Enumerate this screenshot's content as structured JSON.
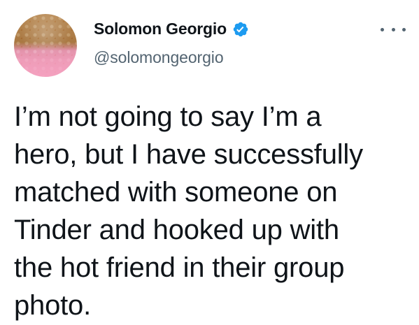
{
  "author": {
    "display_name": "Solomon Georgio",
    "handle": "@solomongeorgio",
    "verified": true,
    "verified_color": "#1d9bf0"
  },
  "actions": {
    "more_icon": "more-horizontal-icon"
  },
  "tweet": {
    "text": "I’m not going to say I’m a\nhero, but I have successfully\nmatched with someone on\nTinder and hooked up with\nthe hot friend in their group\nphoto."
  },
  "colors": {
    "text": "#0f1419",
    "secondary": "#536471",
    "background": "#ffffff"
  }
}
